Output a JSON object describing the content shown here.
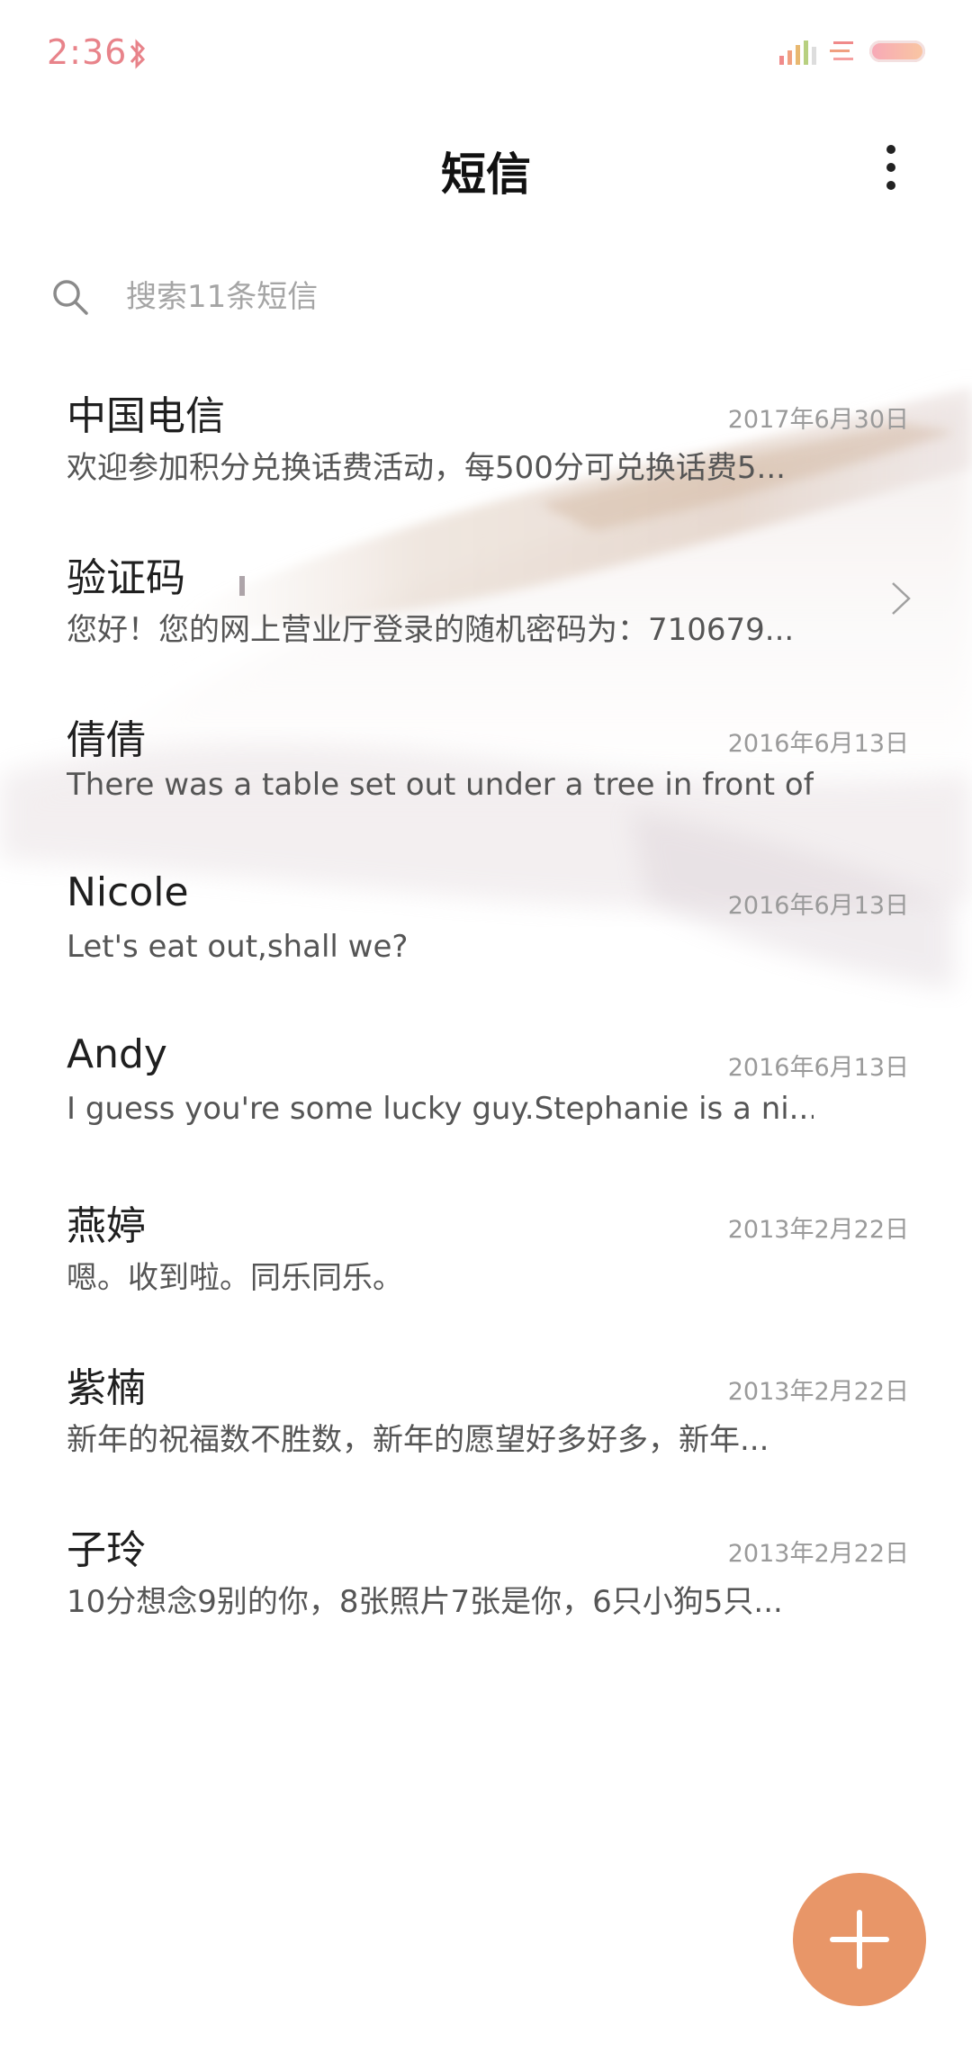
{
  "status_bar": {
    "time": "2:36",
    "icons": [
      "bluetooth-icon",
      "signal-icon",
      "data-icon",
      "battery-icon"
    ],
    "accent_color": "#e8838a"
  },
  "header": {
    "title": "短信",
    "menu_icon": "more-vertical-icon"
  },
  "search": {
    "placeholder": "搜索11条短信",
    "icon": "search-icon"
  },
  "conversations": [
    {
      "name": "中国电信",
      "date": "2017年6月30日",
      "preview": "欢迎参加积分兑换话费活动，每500分可兑换话费5..."
    },
    {
      "name": "验证码",
      "date": "",
      "preview": "您好！您的网上营业厅登录的随机密码为：710679...",
      "has_chevron": true
    },
    {
      "name": "倩倩",
      "date": "2016年6月13日",
      "preview": "There was a table set out under a tree in front of ..."
    },
    {
      "name": "Nicole",
      "date": "2016年6月13日",
      "preview": "Let's eat out,shall we?"
    },
    {
      "name": "Andy",
      "date": "2016年6月13日",
      "preview": "I guess you're some lucky guy.Stephanie is a ni..."
    },
    {
      "name": "燕婷",
      "date": "2013年2月22日",
      "preview": "嗯。收到啦。同乐同乐。"
    },
    {
      "name": "紫楠",
      "date": "2013年2月22日",
      "preview": "新年的祝福数不胜数，新年的愿望好多好多，新年..."
    },
    {
      "name": "子玲",
      "date": "2013年2月22日",
      "preview": "10分想念9别的你，8张照片7张是你，6只小狗5只..."
    }
  ],
  "fab": {
    "icon": "plus-icon",
    "color": "#e89668"
  }
}
